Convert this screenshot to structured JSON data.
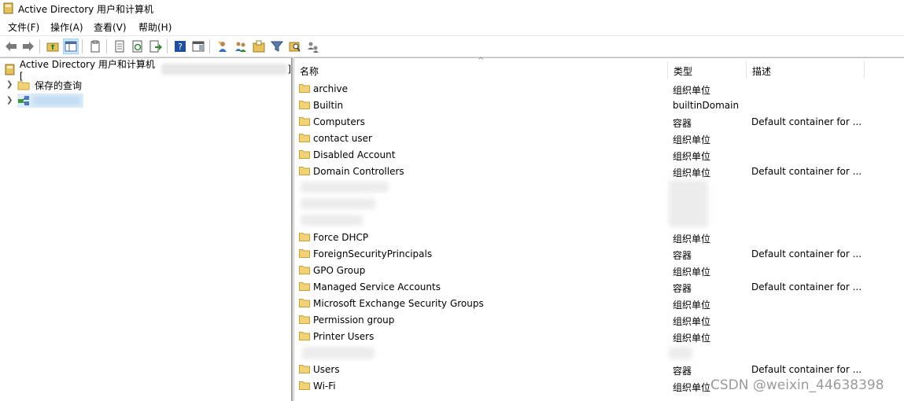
{
  "window": {
    "title": "Active Directory 用户和计算机"
  },
  "menu": [
    "文件(F)",
    "操作(A)",
    "查看(V)",
    "帮助(H)"
  ],
  "toolbar_icons": [
    "back-arrow-icon",
    "forward-arrow-icon",
    "up-folder-icon",
    "console-tree-icon",
    "copy-icon",
    "properties-icon",
    "refresh-icon",
    "export-list-icon",
    "help-icon",
    "show-hide-icon",
    "new-user-icon",
    "new-group-icon",
    "new-ou-icon",
    "filter-icon",
    "find-icon",
    "delegate-icon"
  ],
  "tree": {
    "root_label": "Active Directory 用户和计算机 [",
    "root_suffix": "]",
    "saved_queries": "保存的查询"
  },
  "columns": {
    "name": "名称",
    "type": "类型",
    "description": "描述"
  },
  "rows": [
    {
      "name": "archive",
      "type": "组织单位",
      "description": ""
    },
    {
      "name": "Builtin",
      "type": "builtinDomain",
      "description": ""
    },
    {
      "name": "Computers",
      "type": "容器",
      "description": "Default container for ..."
    },
    {
      "name": "contact user",
      "type": "组织单位",
      "description": ""
    },
    {
      "name": "Disabled Account",
      "type": "组织单位",
      "description": ""
    },
    {
      "name": "Domain Controllers",
      "type": "组织单位",
      "description": "Default container for ..."
    },
    {
      "name": "Force DHCP",
      "type": "组织单位",
      "description": ""
    },
    {
      "name": "ForeignSecurityPrincipals",
      "type": "容器",
      "description": "Default container for ..."
    },
    {
      "name": "GPO Group",
      "type": "组织单位",
      "description": ""
    },
    {
      "name": "Managed Service Accounts",
      "type": "容器",
      "description": "Default container for ..."
    },
    {
      "name": "Microsoft Exchange Security Groups",
      "type": "组织单位",
      "description": ""
    },
    {
      "name": "Permission group",
      "type": "组织单位",
      "description": ""
    },
    {
      "name": "Printer Users",
      "type": "组织单位",
      "description": ""
    },
    {
      "name": "Users",
      "type": "容器",
      "description": "Default container for ..."
    },
    {
      "name": "Wi-Fi",
      "type": "组织单位",
      "description": ""
    }
  ],
  "watermark": "CSDN @weixin_44638398",
  "colors": {
    "folder": "#e8c15a",
    "selection": "#cce8ff"
  }
}
